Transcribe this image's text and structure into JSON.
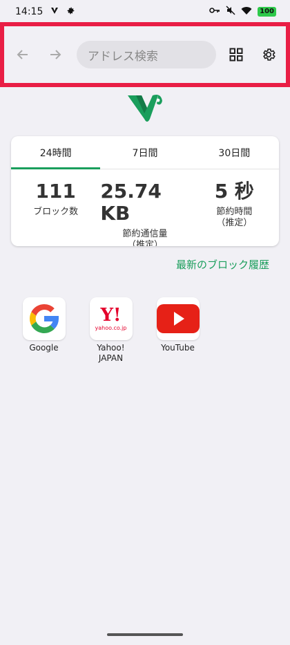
{
  "status_bar": {
    "time": "14:15",
    "battery": "100",
    "icons": [
      "vivaldi-notification-icon",
      "settings-notification-icon",
      "key-icon",
      "mute-icon",
      "wifi-icon",
      "battery-icon"
    ]
  },
  "toolbar": {
    "back_icon": "arrow-back-icon",
    "forward_icon": "arrow-forward-icon",
    "address_placeholder": "アドレス検索",
    "tabs_icon": "grid-icon",
    "settings_icon": "gear-icon"
  },
  "stats": {
    "tabs": [
      {
        "label": "24時間",
        "active": true
      },
      {
        "label": "7日間",
        "active": false
      },
      {
        "label": "30日間",
        "active": false
      }
    ],
    "items": [
      {
        "value": "111",
        "label": "ブロック数"
      },
      {
        "value": "25.74 KB",
        "label": "節約通信量\n（推定）"
      },
      {
        "value": "5 秒",
        "label": "節約時間\n（推定）"
      }
    ]
  },
  "history_link": "最新のブロック履歴",
  "shortcuts": [
    {
      "label": "Google",
      "icon": "google-icon"
    },
    {
      "label": "Yahoo!\nJAPAN",
      "icon": "yahoo-japan-icon",
      "icon_text": "Y!",
      "icon_subtext": "yahoo.co.jp"
    },
    {
      "label": "YouTube",
      "icon": "youtube-icon"
    }
  ],
  "colors": {
    "accent": "#1a9e5c",
    "highlight_border": "#e91e45",
    "background": "#f1f0f5"
  }
}
